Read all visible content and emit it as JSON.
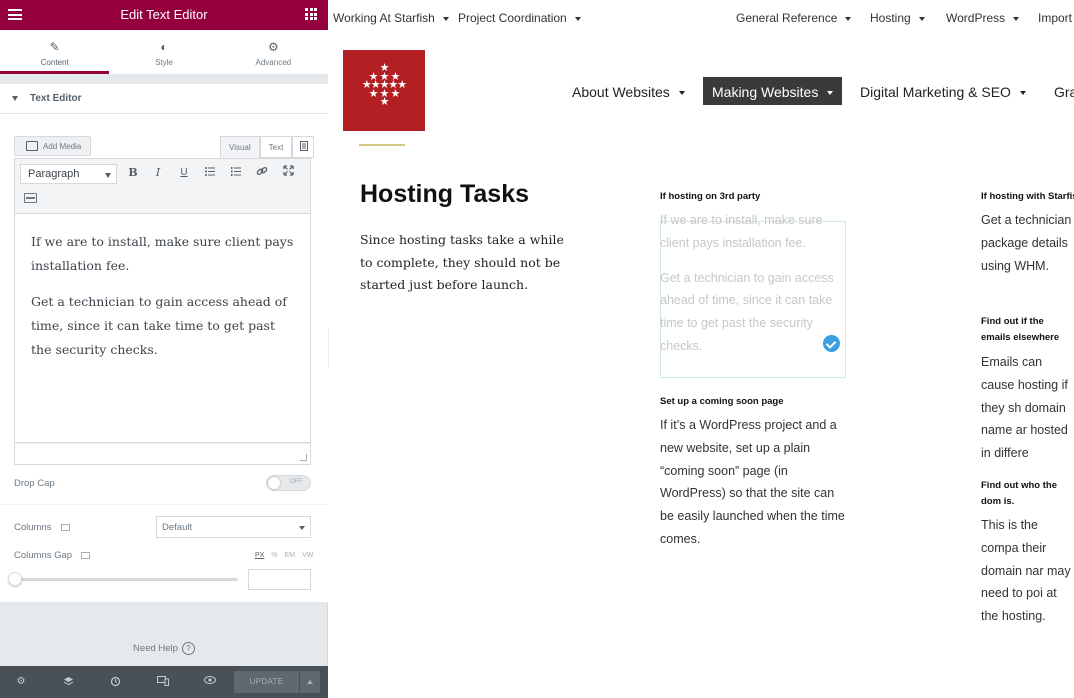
{
  "panel": {
    "title": "Edit Text Editor",
    "tabs": [
      {
        "label": "Content",
        "icon": "pencil-icon"
      },
      {
        "label": "Style",
        "icon": "contrast-icon"
      },
      {
        "label": "Advanced",
        "icon": "gear-icon"
      }
    ],
    "section_title": "Text Editor",
    "add_media_label": "Add Media",
    "mode_visual": "Visual",
    "mode_text": "Text",
    "format_value": "Paragraph",
    "editor_paragraphs": [
      "If we are to install, make sure client pays installation fee.",
      "Get a technician to gain access ahead of time, since it can take time to get past the security checks."
    ],
    "drop_cap_label": "Drop Cap",
    "drop_cap_state": "OFF",
    "columns_label": "Columns",
    "columns_value": "Default",
    "columns_gap_label": "Columns Gap",
    "units": [
      "PX",
      "%",
      "EM",
      "VW"
    ],
    "columns_gap_value": "",
    "need_help": "Need Help",
    "update_label": "UPDATE"
  },
  "site": {
    "topnav": [
      "Working At Starfish",
      "Project Coordination",
      "General Reference",
      "Hosting",
      "WordPress",
      "Import"
    ],
    "mainnav": [
      "About Websites",
      "Making Websites",
      "Digital Marketing & SEO",
      "Gra"
    ],
    "page_title": "Hosting Tasks",
    "intro": "Since hosting tasks take a while to complete, they should not be started just before launch.",
    "col2": {
      "head1": "If hosting on 3rd party",
      "text1": [
        "If we are to install, make sure client pays installation fee.",
        "Get a technician to gain access ahead of time, since it can take time to get past the security checks."
      ],
      "head2": "Set up a coming soon page",
      "text2": "If it’s a WordPress project and a new website, set up a plain “coming soon” page (in WordPress) so that the site can be easily launched when the time comes."
    },
    "col3": {
      "head1": "If hosting with Starfis",
      "text1": "Get a technician package details using WHM.",
      "head2": "Find out if the emails elsewhere",
      "text2": "Emails can cause hosting if they sh domain name ar hosted in differe",
      "head3": "Find out who the dom is.",
      "text3": "This is the compa their domain nar may need to poi at the hosting."
    }
  },
  "colors": {
    "brand": "#93003c",
    "logo": "#b22024",
    "active_nav": "#3a3a3a",
    "check": "#3b9fe0"
  }
}
